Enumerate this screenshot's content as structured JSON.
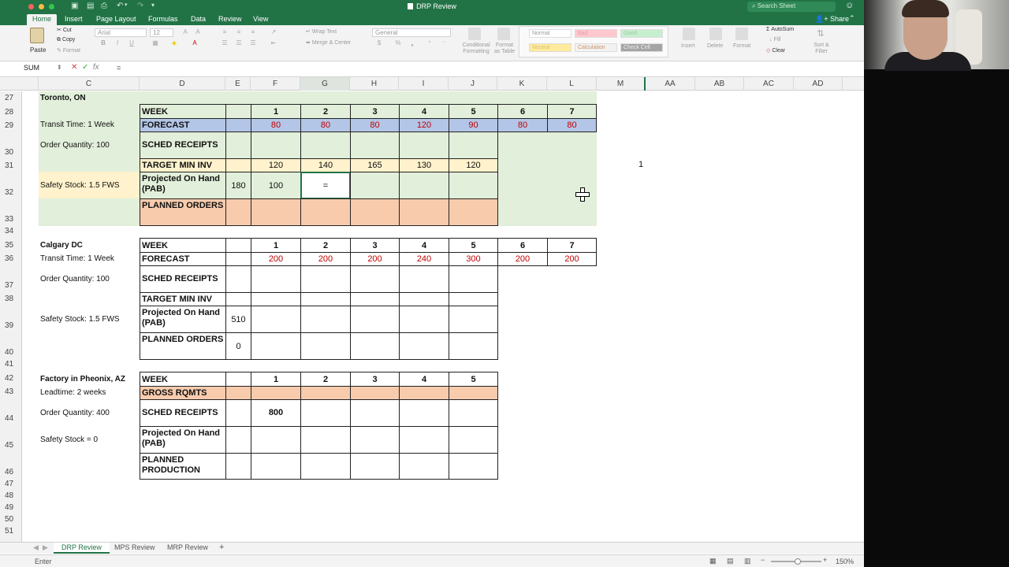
{
  "window": {
    "title": "DRP Review"
  },
  "search": {
    "placeholder": "Search Sheet"
  },
  "tabs": [
    {
      "label": "Home",
      "active": true
    },
    {
      "label": "Insert"
    },
    {
      "label": "Page Layout"
    },
    {
      "label": "Formulas"
    },
    {
      "label": "Data"
    },
    {
      "label": "Review"
    },
    {
      "label": "View"
    }
  ],
  "share_label": "Share",
  "ribbon": {
    "paste": "Paste",
    "cut": "Cut",
    "copy": "Copy",
    "format": "Format",
    "font_name": "Arial",
    "font_size": "12",
    "wrap_text": "Wrap Text",
    "merge_center": "Merge & Center",
    "number_format": "General",
    "conditional_formatting": "Conditional Formatting",
    "format_as_table": "Format as Table",
    "styles": {
      "normal": "Normal",
      "bad": "Bad",
      "good": "Good",
      "neutral": "Neutral",
      "calculation": "Calculation",
      "check_cell": "Check Cell"
    },
    "insert": "Insert",
    "delete": "Delete",
    "format_cells": "Format",
    "autosum": "AutoSum",
    "fill": "Fill",
    "clear": "Clear",
    "sort_filter": "Sort & Filter"
  },
  "formula_bar": {
    "name_box": "SUM",
    "formula": "="
  },
  "columns": [
    "C",
    "D",
    "E",
    "F",
    "G",
    "H",
    "I",
    "J",
    "K",
    "L",
    "M",
    "AA",
    "AB",
    "AC",
    "AD"
  ],
  "rows": [
    "27",
    "28",
    "29",
    "30",
    "31",
    "32",
    "33",
    "34",
    "35",
    "36",
    "37",
    "38",
    "39",
    "40",
    "41",
    "42",
    "43",
    "44",
    "45",
    "46",
    "47",
    "48",
    "49",
    "50",
    "51"
  ],
  "toronto": {
    "name": "Toronto, ON",
    "transit": "Transit Time: 1 Week",
    "order_qty": "Order Quantity: 100",
    "safety": "Safety Stock: 1.5 FWS",
    "labels": {
      "week": "WEEK",
      "forecast": "FORECAST",
      "sched": "SCHED RECEIPTS",
      "target": "TARGET MIN INV",
      "pab": "Projected On Hand (PAB)",
      "planned": "PLANNED ORDERS"
    },
    "weeks": [
      "1",
      "2",
      "3",
      "4",
      "5",
      "6",
      "7"
    ],
    "forecast": [
      "80",
      "80",
      "80",
      "120",
      "90",
      "80",
      "80"
    ],
    "target": [
      "120",
      "140",
      "165",
      "130",
      "120"
    ],
    "pab_start": "180",
    "pab": [
      "100",
      "=",
      "",
      "",
      ""
    ],
    "side_value": "1"
  },
  "calgary": {
    "name": "Calgary DC",
    "transit": "Transit Time: 1 Week",
    "order_qty": "Order Quantity: 100",
    "safety": "Safety Stock: 1.5 FWS",
    "labels": {
      "week": "WEEK",
      "forecast": "FORECAST",
      "sched": "SCHED RECEIPTS",
      "target": "TARGET MIN INV",
      "pab": "Projected On Hand (PAB)",
      "planned": "PLANNED ORDERS"
    },
    "weeks": [
      "1",
      "2",
      "3",
      "4",
      "5",
      "6",
      "7"
    ],
    "forecast": [
      "200",
      "200",
      "200",
      "240",
      "300",
      "200",
      "200"
    ],
    "pab_start": "510",
    "planned_start": "0"
  },
  "factory": {
    "name": "Factory in Pheonix,  AZ",
    "leadtime": "Leadtime: 2 weeks",
    "order_qty": "Order Quantity: 400",
    "safety": "Safety Stock = 0",
    "labels": {
      "week": "WEEK",
      "gross": "GROSS RQMTS",
      "sched": "SCHED RECEIPTS",
      "pab": "Projected On Hand (PAB)",
      "planned": "PLANNED PRODUCTION"
    },
    "weeks": [
      "1",
      "2",
      "3",
      "4",
      "5"
    ],
    "sched_first": "800"
  },
  "sheets": [
    {
      "label": "DRP Review",
      "active": true
    },
    {
      "label": "MPS Review"
    },
    {
      "label": "MRP Review"
    }
  ],
  "status": {
    "mode": "Enter",
    "zoom": "150%"
  },
  "colors": {
    "excel_green": "#217346",
    "region_green": "#e2efda",
    "forecast_blue": "#b4c6e7",
    "target_yellow": "#fff2cc",
    "pab_yellow": "#fce4b0",
    "planned_orange": "#f8cbad",
    "forecast_red": "#c00000"
  }
}
